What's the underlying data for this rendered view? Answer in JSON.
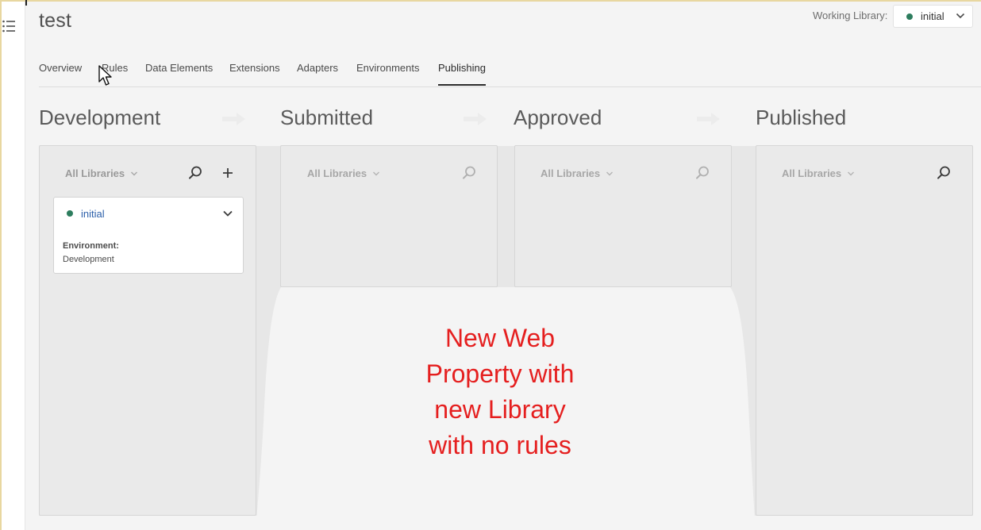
{
  "page": {
    "title": "test"
  },
  "working_library": {
    "label": "Working Library:",
    "value": "initial"
  },
  "tabs": [
    {
      "label": "Overview"
    },
    {
      "label": "Rules"
    },
    {
      "label": "Data Elements"
    },
    {
      "label": "Extensions"
    },
    {
      "label": "Adapters"
    },
    {
      "label": "Environments"
    },
    {
      "label": "Publishing",
      "active": true
    }
  ],
  "columns": [
    {
      "title": "Development",
      "filter": "All Libraries"
    },
    {
      "title": "Submitted",
      "filter": "All Libraries"
    },
    {
      "title": "Approved",
      "filter": "All Libraries"
    },
    {
      "title": "Published",
      "filter": "All Libraries"
    }
  ],
  "library_card": {
    "name": "initial",
    "env_label": "Environment:",
    "env_value": "Development"
  },
  "annotation": {
    "lines": [
      "New Web",
      "Property with",
      "new Library",
      "with no rules"
    ]
  },
  "colors": {
    "accent_green": "#2d7d5e",
    "link_blue": "#2b5faa",
    "annotation_red": "#e51f1f"
  },
  "icons": [
    "menu-icon",
    "chevron-down-icon",
    "search-icon",
    "plus-icon",
    "arrow-right-icon",
    "mouse-cursor-icon"
  ]
}
